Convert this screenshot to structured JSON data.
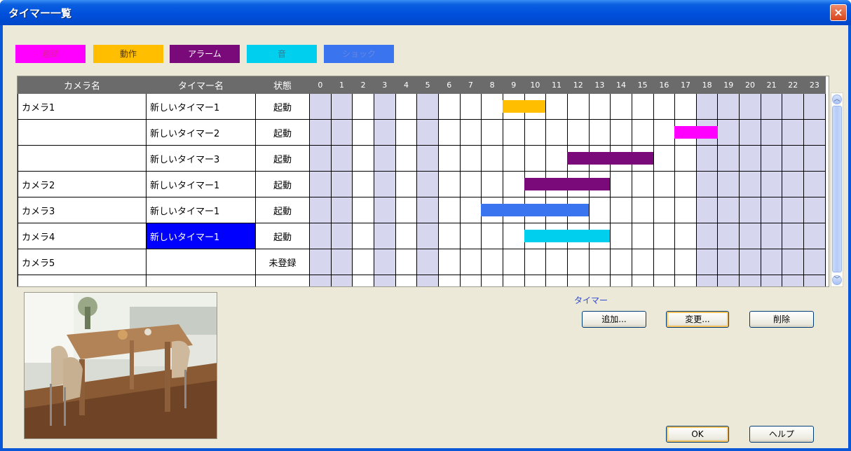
{
  "window": {
    "title": "タイマー一覧",
    "close_glyph": "×"
  },
  "legend": [
    {
      "label": "連続",
      "color": "#ff00ff",
      "text_color": "#e0209a"
    },
    {
      "label": "動作",
      "color": "#ffbf00",
      "text_color": "#5a3c00"
    },
    {
      "label": "アラーム",
      "color": "#7a0a7a",
      "text_color": "#ffffff"
    },
    {
      "label": "音",
      "color": "#00d0ee",
      "text_color": "#2e7f9a"
    },
    {
      "label": "ショック",
      "color": "#3a74ee",
      "text_color": "#6a86e0"
    }
  ],
  "grid": {
    "headers": {
      "camera": "カメラ名",
      "timer": "タイマー名",
      "state": "状態"
    },
    "hours": [
      "0",
      "1",
      "2",
      "3",
      "4",
      "5",
      "6",
      "7",
      "8",
      "9",
      "10",
      "11",
      "12",
      "13",
      "14",
      "15",
      "16",
      "17",
      "18",
      "19",
      "20",
      "21",
      "22",
      "23"
    ],
    "rows": [
      {
        "camera": "カメラ1",
        "timer": "新しいタイマー1",
        "state": "起動",
        "selected": false
      },
      {
        "camera": "",
        "timer": "新しいタイマー2",
        "state": "起動",
        "selected": false
      },
      {
        "camera": "",
        "timer": "新しいタイマー3",
        "state": "起動",
        "selected": false
      },
      {
        "camera": "カメラ2",
        "timer": "新しいタイマー1",
        "state": "起動",
        "selected": false
      },
      {
        "camera": "カメラ3",
        "timer": "新しいタイマー1",
        "state": "起動",
        "selected": false
      },
      {
        "camera": "カメラ4",
        "timer": "新しいタイマー1",
        "state": "起動",
        "selected": true
      },
      {
        "camera": "カメラ5",
        "timer": "",
        "state": "未登録",
        "selected": false
      },
      {
        "camera": "",
        "timer": "",
        "state": "",
        "selected": false
      }
    ],
    "schedules": [
      {
        "row": 0,
        "start": 9,
        "end": 11,
        "type": "動作",
        "color": "#ffbf00"
      },
      {
        "row": 1,
        "start": 17,
        "end": 19,
        "type": "連続",
        "color": "#ff00ff"
      },
      {
        "row": 2,
        "start": 12,
        "end": 16,
        "type": "アラーム",
        "color": "#7a0a7a"
      },
      {
        "row": 3,
        "start": 10,
        "end": 14,
        "type": "アラーム",
        "color": "#7a0a7a"
      },
      {
        "row": 4,
        "start": 8,
        "end": 13,
        "type": "ショック",
        "color": "#3a74ee"
      },
      {
        "row": 5,
        "start": 10,
        "end": 14,
        "type": "音",
        "color": "#00d0ee"
      }
    ]
  },
  "scrollbar": {
    "up_glyph": "︿",
    "down_glyph": "﹀"
  },
  "timer_group": {
    "label": "タイマー",
    "add": "追加...",
    "change": "変更...",
    "delete": "削除"
  },
  "footer": {
    "ok": "OK",
    "help": "ヘルプ"
  }
}
